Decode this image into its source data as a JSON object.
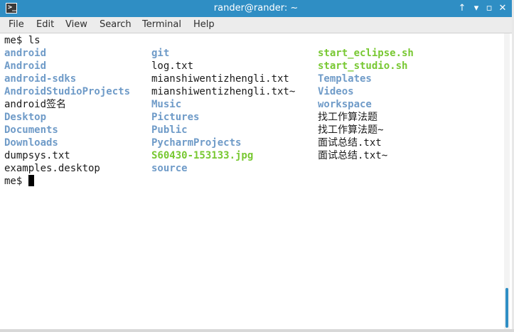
{
  "window": {
    "title": "rander@rander: ~",
    "icon": "terminal-icon",
    "buttons": [
      {
        "name": "keep-above-button",
        "glyph": "↑"
      },
      {
        "name": "minimize-button",
        "glyph": "▾"
      },
      {
        "name": "maximize-button",
        "glyph": "▫"
      },
      {
        "name": "close-button",
        "glyph": "✕"
      }
    ]
  },
  "menu": [
    "File",
    "Edit",
    "View",
    "Search",
    "Terminal",
    "Help"
  ],
  "terminal": {
    "prompt_command": "me$ ls",
    "prompt_end": "me$ ",
    "col1": [
      {
        "text": "android",
        "type": "dir"
      },
      {
        "text": "Android",
        "type": "dir"
      },
      {
        "text": "android-sdks",
        "type": "dir"
      },
      {
        "text": "AndroidStudioProjects",
        "type": "dir"
      },
      {
        "text": "android签名",
        "type": "plain"
      },
      {
        "text": "Desktop",
        "type": "dir"
      },
      {
        "text": "Documents",
        "type": "dir"
      },
      {
        "text": "Downloads",
        "type": "dir"
      },
      {
        "text": "dumpsys.txt",
        "type": "plain"
      },
      {
        "text": "examples.desktop",
        "type": "plain"
      }
    ],
    "col2": [
      {
        "text": "git",
        "type": "dir"
      },
      {
        "text": "log.txt",
        "type": "plain"
      },
      {
        "text": "mianshiwentizhengli.txt",
        "type": "plain"
      },
      {
        "text": "mianshiwentizhengli.txt~",
        "type": "plain"
      },
      {
        "text": "Music",
        "type": "dir"
      },
      {
        "text": "Pictures",
        "type": "dir"
      },
      {
        "text": "Public",
        "type": "dir"
      },
      {
        "text": "PycharmProjects",
        "type": "dir"
      },
      {
        "text": "S60430-153133.jpg",
        "type": "img"
      },
      {
        "text": "source",
        "type": "dir"
      }
    ],
    "col3": [
      {
        "text": "start_eclipse.sh",
        "type": "exe"
      },
      {
        "text": "start_studio.sh",
        "type": "exe"
      },
      {
        "text": "Templates",
        "type": "dir"
      },
      {
        "text": "Videos",
        "type": "dir"
      },
      {
        "text": "workspace",
        "type": "dir"
      },
      {
        "text": "找工作算法题",
        "type": "plain"
      },
      {
        "text": "找工作算法题~",
        "type": "plain"
      },
      {
        "text": "面试总结.txt",
        "type": "plain"
      },
      {
        "text": "面试总结.txt~",
        "type": "plain"
      }
    ]
  },
  "colors": {
    "titlebar": "#2f8ec4",
    "directory": "#6f9bc8",
    "executable": "#78c832",
    "text": "#1a1a1a"
  }
}
